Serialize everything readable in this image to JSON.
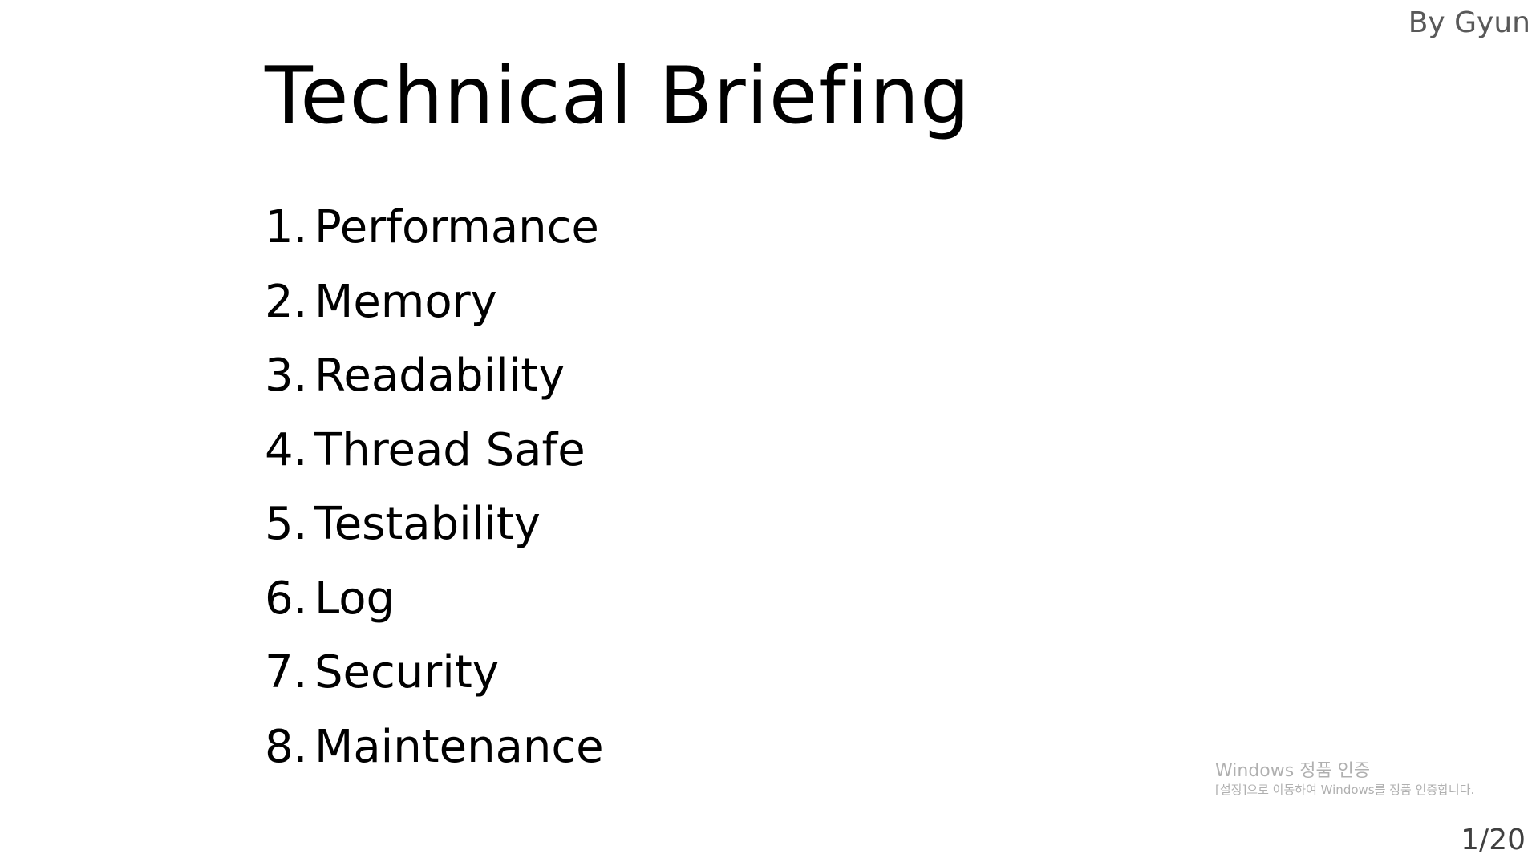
{
  "author": "By Gyun",
  "title": "Technical Briefing",
  "agenda": [
    {
      "number": "1.",
      "label": "Performance"
    },
    {
      "number": "2.",
      "label": "Memory"
    },
    {
      "number": "3.",
      "label": "Readability"
    },
    {
      "number": "4.",
      "label": "Thread Safe"
    },
    {
      "number": "5.",
      "label": "Testability"
    },
    {
      "number": "6.",
      "label": "Log"
    },
    {
      "number": "7.",
      "label": "Security"
    },
    {
      "number": "8.",
      "label": "Maintenance"
    }
  ],
  "watermark": {
    "title": "Windows 정품 인증",
    "subtitle": "[설정]으로 이동하여 Windows를 정품 인증합니다."
  },
  "page_number": "1/20",
  "colors": {
    "background": "#ffffff",
    "text": "#000000",
    "author": "#595959",
    "watermark": "#b0b0b0"
  }
}
